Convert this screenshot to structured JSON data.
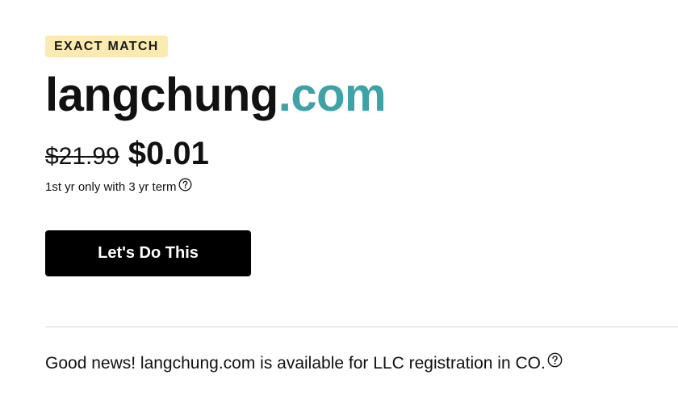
{
  "badge": {
    "label": "EXACT MATCH"
  },
  "domain": {
    "name": "langchung",
    "tld": ".com"
  },
  "pricing": {
    "original_price": "$21.99",
    "sale_price": "$0.01",
    "term_text": "1st yr only with 3 yr term"
  },
  "cta": {
    "label": "Let's Do This"
  },
  "notice": {
    "text": "Good news! langchung.com is available for LLC registration in CO."
  },
  "icons": {
    "term_help": "question-circle-icon",
    "notice_help": "question-circle-icon"
  },
  "colors": {
    "badge_background": "#fcebb0",
    "tld_accent": "#3fa2a6",
    "button_background": "#000000",
    "button_text": "#ffffff"
  }
}
